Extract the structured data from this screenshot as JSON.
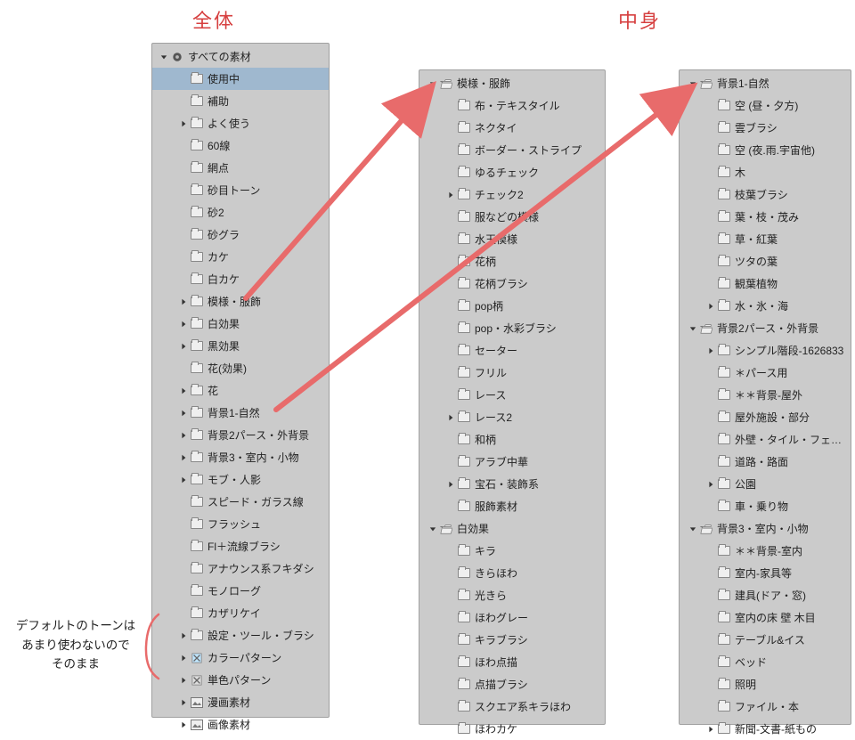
{
  "headers": {
    "left": "全体",
    "right": "中身"
  },
  "note": "デフォルトのトーンは\nあまり使わないので\nそのまま",
  "arrows": {
    "color": "#e86b6b"
  },
  "panels": {
    "left": {
      "root": {
        "label": "すべての素材",
        "iconType": "circle"
      },
      "items": [
        {
          "label": "使用中",
          "depth": 1,
          "caret": "none",
          "selected": true
        },
        {
          "label": "補助",
          "depth": 1,
          "caret": "none"
        },
        {
          "label": "よく使う",
          "depth": 1,
          "caret": "right"
        },
        {
          "label": "60線",
          "depth": 1,
          "caret": "none"
        },
        {
          "label": "網点",
          "depth": 1,
          "caret": "none"
        },
        {
          "label": "砂目トーン",
          "depth": 1,
          "caret": "none"
        },
        {
          "label": "砂2",
          "depth": 1,
          "caret": "none"
        },
        {
          "label": "砂グラ",
          "depth": 1,
          "caret": "none"
        },
        {
          "label": "カケ",
          "depth": 1,
          "caret": "none"
        },
        {
          "label": "白カケ",
          "depth": 1,
          "caret": "none"
        },
        {
          "label": "模様・服飾",
          "depth": 1,
          "caret": "right"
        },
        {
          "label": "白効果",
          "depth": 1,
          "caret": "right"
        },
        {
          "label": "黒効果",
          "depth": 1,
          "caret": "right"
        },
        {
          "label": "花(効果)",
          "depth": 1,
          "caret": "none"
        },
        {
          "label": "花",
          "depth": 1,
          "caret": "right"
        },
        {
          "label": "背景1-自然",
          "depth": 1,
          "caret": "right"
        },
        {
          "label": "背景2パース・外背景",
          "depth": 1,
          "caret": "right"
        },
        {
          "label": "背景3・室内・小物",
          "depth": 1,
          "caret": "right"
        },
        {
          "label": "モブ・人影",
          "depth": 1,
          "caret": "right"
        },
        {
          "label": "スピード・ガラス線",
          "depth": 1,
          "caret": "none"
        },
        {
          "label": "フラッシュ",
          "depth": 1,
          "caret": "none"
        },
        {
          "label": "Fl＋流線ブラシ",
          "depth": 1,
          "caret": "none"
        },
        {
          "label": "アナウンス系フキダシ",
          "depth": 1,
          "caret": "none"
        },
        {
          "label": "モノローグ",
          "depth": 1,
          "caret": "none"
        },
        {
          "label": "カザリケイ",
          "depth": 1,
          "caret": "none"
        },
        {
          "label": "設定・ツール・ブラシ",
          "depth": 1,
          "caret": "right"
        },
        {
          "label": "カラーパターン",
          "depth": 1,
          "caret": "right",
          "iconType": "xblue"
        },
        {
          "label": "単色パターン",
          "depth": 1,
          "caret": "right",
          "iconType": "xgray"
        },
        {
          "label": "漫画素材",
          "depth": 1,
          "caret": "right",
          "iconType": "img"
        },
        {
          "label": "画像素材",
          "depth": 1,
          "caret": "right",
          "iconType": "img"
        }
      ]
    },
    "mid": {
      "items": [
        {
          "label": "模様・服飾",
          "depth": 0,
          "caret": "down",
          "open": true
        },
        {
          "label": "布・テキスタイル",
          "depth": 1,
          "caret": "none"
        },
        {
          "label": "ネクタイ",
          "depth": 1,
          "caret": "none"
        },
        {
          "label": "ボーダー・ストライプ",
          "depth": 1,
          "caret": "none"
        },
        {
          "label": "ゆるチェック",
          "depth": 1,
          "caret": "none"
        },
        {
          "label": "チェック2",
          "depth": 1,
          "caret": "right"
        },
        {
          "label": "服などの模様",
          "depth": 1,
          "caret": "none"
        },
        {
          "label": "水玉模様",
          "depth": 1,
          "caret": "none"
        },
        {
          "label": "花柄",
          "depth": 1,
          "caret": "none"
        },
        {
          "label": "花柄ブラシ",
          "depth": 1,
          "caret": "none"
        },
        {
          "label": "pop柄",
          "depth": 1,
          "caret": "none"
        },
        {
          "label": "pop・水彩ブラシ",
          "depth": 1,
          "caret": "none"
        },
        {
          "label": "セーター",
          "depth": 1,
          "caret": "none"
        },
        {
          "label": "フリル",
          "depth": 1,
          "caret": "none"
        },
        {
          "label": "レース",
          "depth": 1,
          "caret": "none"
        },
        {
          "label": "レース2",
          "depth": 1,
          "caret": "right"
        },
        {
          "label": "和柄",
          "depth": 1,
          "caret": "none"
        },
        {
          "label": "アラブ中華",
          "depth": 1,
          "caret": "none"
        },
        {
          "label": "宝石・装飾系",
          "depth": 1,
          "caret": "right"
        },
        {
          "label": "服飾素材",
          "depth": 1,
          "caret": "none"
        },
        {
          "label": "白効果",
          "depth": 0,
          "caret": "down",
          "open": true
        },
        {
          "label": "キラ",
          "depth": 1,
          "caret": "none"
        },
        {
          "label": "きらほわ",
          "depth": 1,
          "caret": "none"
        },
        {
          "label": "光きら",
          "depth": 1,
          "caret": "none"
        },
        {
          "label": "ほわグレー",
          "depth": 1,
          "caret": "none"
        },
        {
          "label": "キラブラシ",
          "depth": 1,
          "caret": "none"
        },
        {
          "label": "ほわ点描",
          "depth": 1,
          "caret": "none"
        },
        {
          "label": "点描ブラシ",
          "depth": 1,
          "caret": "none"
        },
        {
          "label": "スクエア系キラほわ",
          "depth": 1,
          "caret": "none"
        },
        {
          "label": "ほわカケ",
          "depth": 1,
          "caret": "none"
        }
      ]
    },
    "right": {
      "items": [
        {
          "label": "背景1-自然",
          "depth": 0,
          "caret": "down",
          "open": true
        },
        {
          "label": "空 (昼・夕方)",
          "depth": 1,
          "caret": "none"
        },
        {
          "label": "雲ブラシ",
          "depth": 1,
          "caret": "none"
        },
        {
          "label": "空 (夜.雨.宇宙他)",
          "depth": 1,
          "caret": "none"
        },
        {
          "label": "木",
          "depth": 1,
          "caret": "none"
        },
        {
          "label": "枝葉ブラシ",
          "depth": 1,
          "caret": "none"
        },
        {
          "label": "葉・枝・茂み",
          "depth": 1,
          "caret": "none"
        },
        {
          "label": "草・紅葉",
          "depth": 1,
          "caret": "none"
        },
        {
          "label": "ツタの葉",
          "depth": 1,
          "caret": "none"
        },
        {
          "label": "観葉植物",
          "depth": 1,
          "caret": "none"
        },
        {
          "label": "水・氷・海",
          "depth": 1,
          "caret": "right"
        },
        {
          "label": "背景2パース・外背景",
          "depth": 0,
          "caret": "down",
          "open": true
        },
        {
          "label": "シンプル階段-1626833",
          "depth": 1,
          "caret": "right"
        },
        {
          "label": "＊パース用",
          "depth": 1,
          "caret": "none"
        },
        {
          "label": "＊＊背景-屋外",
          "depth": 1,
          "caret": "none"
        },
        {
          "label": "屋外施設・部分",
          "depth": 1,
          "caret": "none"
        },
        {
          "label": "外壁・タイル・フェンス",
          "depth": 1,
          "caret": "none"
        },
        {
          "label": "道路・路面",
          "depth": 1,
          "caret": "none"
        },
        {
          "label": "公園",
          "depth": 1,
          "caret": "right"
        },
        {
          "label": "車・乗り物",
          "depth": 1,
          "caret": "none"
        },
        {
          "label": "背景3・室内・小物",
          "depth": 0,
          "caret": "down",
          "open": true
        },
        {
          "label": "＊＊背景-室内",
          "depth": 1,
          "caret": "none"
        },
        {
          "label": "室内-家具等",
          "depth": 1,
          "caret": "none"
        },
        {
          "label": "建具(ドア・窓)",
          "depth": 1,
          "caret": "none"
        },
        {
          "label": "室内の床 壁 木目",
          "depth": 1,
          "caret": "none"
        },
        {
          "label": "テーブル&イス",
          "depth": 1,
          "caret": "none"
        },
        {
          "label": "ベッド",
          "depth": 1,
          "caret": "none"
        },
        {
          "label": "照明",
          "depth": 1,
          "caret": "none"
        },
        {
          "label": "ファイル・本",
          "depth": 1,
          "caret": "none"
        },
        {
          "label": "新聞-文書-紙もの",
          "depth": 1,
          "caret": "right"
        }
      ]
    }
  }
}
